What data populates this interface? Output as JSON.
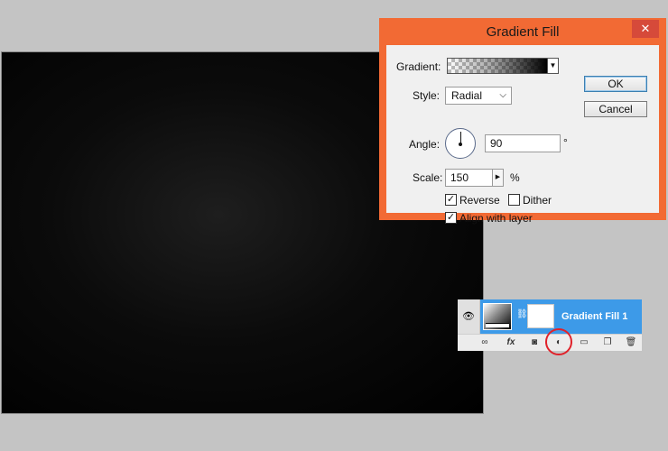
{
  "dialog": {
    "title": "Gradient Fill",
    "close_label": "✕",
    "gradient_label": "Gradient:",
    "style_label": "Style:",
    "style_value": "Radial",
    "angle_label": "Angle:",
    "angle_value": "90",
    "degree_symbol": "°",
    "scale_label": "Scale:",
    "scale_value": "150",
    "percent_symbol": "%",
    "reverse_label": "Reverse",
    "reverse_checked": true,
    "dither_label": "Dither",
    "dither_checked": false,
    "align_label": "Align with layer",
    "align_checked": true,
    "ok_label": "OK",
    "cancel_label": "Cancel"
  },
  "layers": {
    "layer_name": "Gradient Fill 1"
  },
  "colors": {
    "dialog_accent": "#f26a34",
    "selection": "#3d9ae8",
    "highlight": "#e0222a"
  },
  "icons": {
    "eye": "eye-icon",
    "link": "link-icon",
    "fx": "fx-icon",
    "mask": "add-mask-icon",
    "adjustment": "adjustment-layer-icon",
    "group": "folder-icon",
    "new_layer": "new-layer-icon",
    "trash": "trash-icon"
  }
}
